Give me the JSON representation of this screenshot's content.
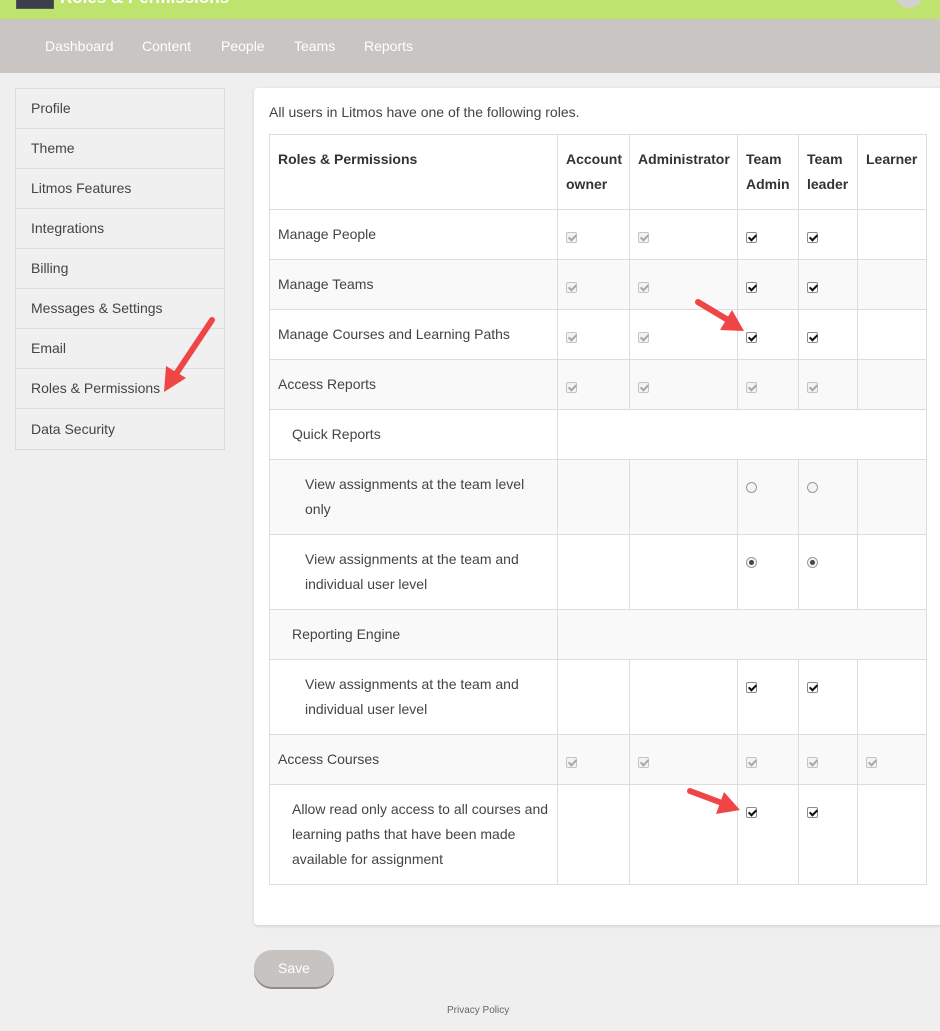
{
  "header": {
    "title": "Roles & Permissions"
  },
  "nav": [
    "Dashboard",
    "Content",
    "People",
    "Teams",
    "Reports"
  ],
  "sidebar": [
    "Profile",
    "Theme",
    "Litmos Features",
    "Integrations",
    "Billing",
    "Messages & Settings",
    "Email",
    "Roles & Permissions",
    "Data Security"
  ],
  "main": {
    "intro": "All users in Litmos have one of the following roles.",
    "columns": [
      "Roles & Permissions",
      "Account owner",
      "Administrator",
      "Team Admin",
      "Team leader",
      "Learner"
    ],
    "rows": [
      {
        "label": "Manage People",
        "cells": [
          "checked-disabled",
          "checked-disabled",
          "checked",
          "checked",
          ""
        ]
      },
      {
        "label": "Manage Teams",
        "cells": [
          "checked-disabled",
          "checked-disabled",
          "checked",
          "checked",
          ""
        ]
      },
      {
        "label": "Manage Courses and Learning Paths",
        "cells": [
          "checked-disabled",
          "checked-disabled",
          "checked",
          "checked",
          ""
        ]
      },
      {
        "label": "Access Reports",
        "cells": [
          "checked-disabled",
          "checked-disabled",
          "checked-disabled",
          "checked-disabled",
          ""
        ]
      },
      {
        "label": "Quick Reports",
        "section": true
      },
      {
        "label": "View assignments at the team level only",
        "cells": [
          "",
          "",
          "radio",
          "radio",
          ""
        ]
      },
      {
        "label": "View assignments at the team and individual user level",
        "cells": [
          "",
          "",
          "radio-selected",
          "radio-selected",
          ""
        ]
      },
      {
        "label": "Reporting Engine",
        "section": true
      },
      {
        "label": "View assignments at the team and individual user level",
        "cells": [
          "",
          "",
          "checked",
          "checked",
          ""
        ]
      },
      {
        "label": "Access Courses",
        "cells": [
          "checked-disabled",
          "checked-disabled",
          "checked-disabled",
          "checked-disabled",
          "checked-disabled"
        ]
      },
      {
        "label": "Allow read only access to all courses and learning paths that have been made available for assignment",
        "cells": [
          "",
          "",
          "checked",
          "checked",
          ""
        ]
      }
    ]
  },
  "footer": {
    "save_label": "Save",
    "privacy": "Privacy Policy"
  },
  "colors": {
    "topbar": "#bfe36f",
    "navbar": "#c9c5c2",
    "annotation_arrow": "#f04545"
  }
}
